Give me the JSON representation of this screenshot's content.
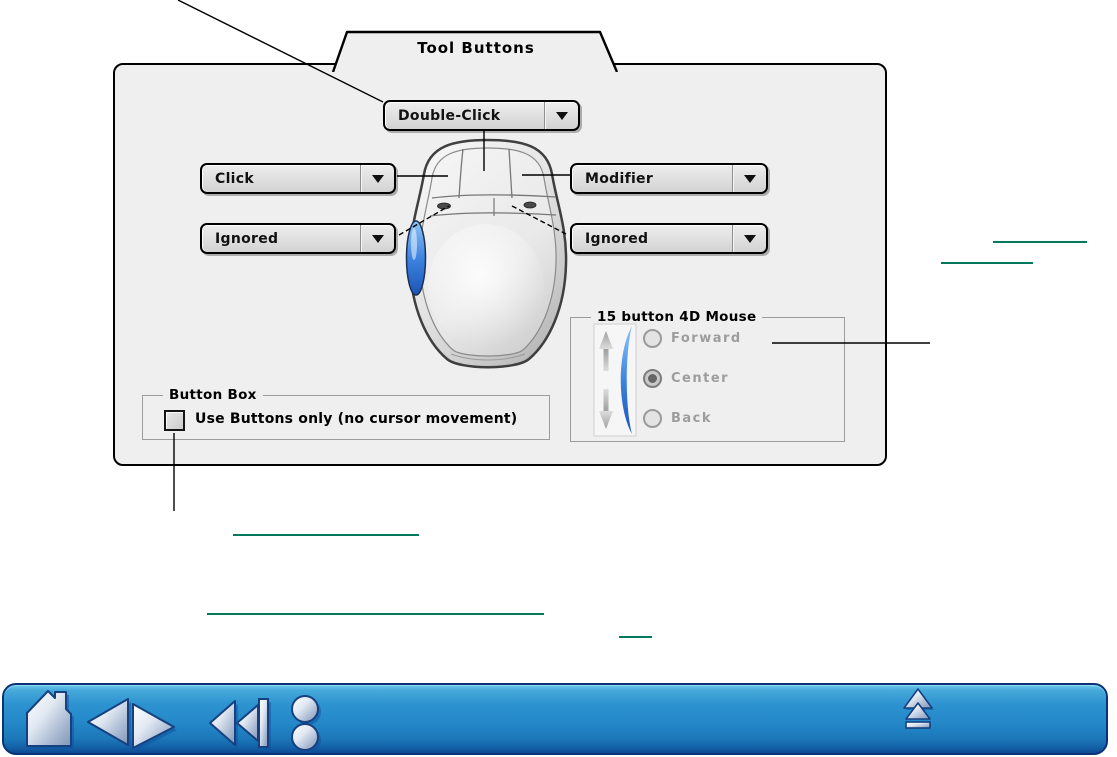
{
  "dialog": {
    "tab_label": "Tool Buttons"
  },
  "dropdowns": {
    "top_label": "Double-Click",
    "upper_left_label": "Click",
    "lower_left_label": "Ignored",
    "upper_right_label": "Modifier",
    "lower_right_label": "Ignored"
  },
  "four_d_mouse_group": {
    "title": "15 button 4D Mouse",
    "radios": [
      {
        "label": "Forward",
        "selected": false
      },
      {
        "label": "Center",
        "selected": true
      },
      {
        "label": "Back",
        "selected": false
      }
    ]
  },
  "button_box_group": {
    "title": "Button Box",
    "checkbox_label": "Use Buttons only (no cursor movement)",
    "checkbox_checked": false
  },
  "colors": {
    "link_underline": "#00795e",
    "nav_bar_blue": "#2a91cf",
    "thumbwheel_blue": "#2e7bdc",
    "dialog_background": "#efefef"
  },
  "nav_bar": {
    "icons": [
      "home-icon",
      "back-icon",
      "forward-icon",
      "rewind-icon",
      "contents-icon",
      "eject-icon"
    ]
  }
}
